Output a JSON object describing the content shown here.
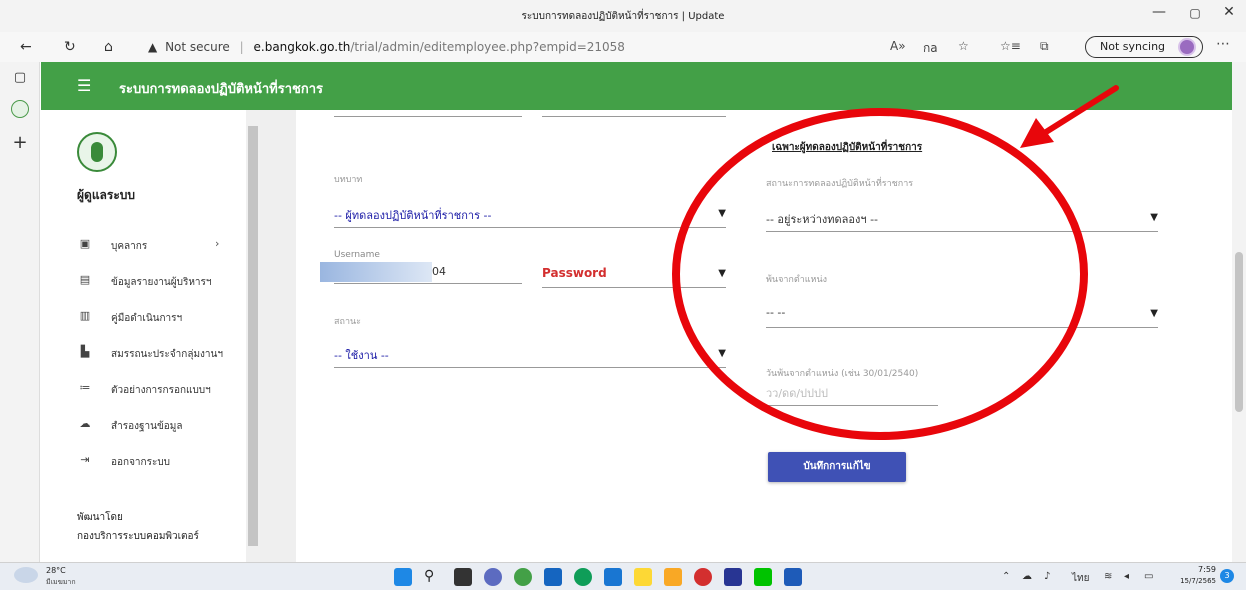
{
  "browser": {
    "window_title": "ระบบการทดลองปฏิบัติหน้าที่ราชการ | Update",
    "security_label": "Not secure",
    "url_host": "e.bangkok.go.th",
    "url_path": "/trial/admin/editemployee.php?empid=21058",
    "sync_label": "Not syncing",
    "read_aloud_icon": "A»",
    "translate_icon": "กa"
  },
  "app": {
    "title": "ระบบการทดลองปฏิบัติหน้าที่ราชการ",
    "accent_green": "#43a047",
    "button_color": "#3f51b5"
  },
  "sidebar": {
    "role": "ผู้ดูแลระบบ",
    "items": [
      {
        "icon": "person-card-icon",
        "label": "บุคลากร",
        "has_chevron": true
      },
      {
        "icon": "report-icon",
        "label": "ข้อมูลรายงานผู้บริหารฯ"
      },
      {
        "icon": "manual-icon",
        "label": "คู่มือดำเนินการฯ"
      },
      {
        "icon": "document-icon",
        "label": "สมรรถนะประจำกลุ่มงานฯ"
      },
      {
        "icon": "list-icon",
        "label": "ตัวอย่างการกรอกแบบฯ"
      },
      {
        "icon": "cloud-upload-icon",
        "label": "สำรองฐานข้อมูล"
      },
      {
        "icon": "logout-icon",
        "label": "ออกจากระบบ"
      }
    ],
    "developed_by_label": "พัฒนาโดย",
    "developer": "กองบริการระบบคอมพิวเตอร์"
  },
  "form": {
    "role_label": "บทบาท",
    "role_value": "-- ผู้ทดลองปฏิบัติหน้าที่ราชการ --",
    "username_label": "Username",
    "username_suffix": "04",
    "password_label": "Password",
    "status_label": "สถานะ",
    "status_value": "-- ใช้งาน --",
    "trial_section_title": "เฉพาะผู้ทดลองปฏิบัติหน้าที่ราชการ",
    "trial_status_label": "สถานะการทดลองปฏิบัติหน้าที่ราชการ",
    "trial_status_value": "-- อยู่ระหว่างทดลองฯ --",
    "leave_position_label": "พ้นจากตำแหน่ง",
    "leave_position_value": "-- --",
    "leave_date_label": "วันพ้นจากตำแหน่ง (เช่น 30/01/2540)",
    "leave_date_placeholder": "วว/ดด/ปปปป",
    "save_button": "บันทึกการแก้ไข"
  },
  "taskbar": {
    "weather_temp": "28°C",
    "weather_desc": "มีเมฆมาก",
    "lang": "ไทย",
    "time": "7:59",
    "date": "15/7/2565",
    "notif_count": "3"
  }
}
